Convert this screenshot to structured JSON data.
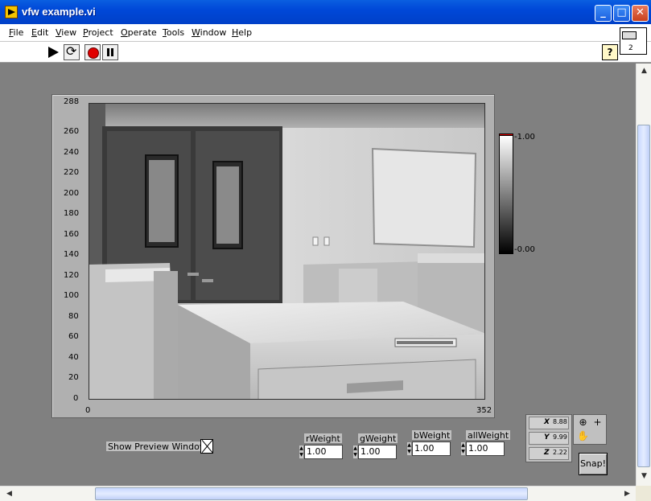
{
  "window": {
    "title": "vfw example.vi",
    "minimize": "_",
    "maximize": "□",
    "close": "✕"
  },
  "menu": [
    "File",
    "Edit",
    "View",
    "Project",
    "Operate",
    "Tools",
    "Window",
    "Help"
  ],
  "toolbar": {
    "help_label": "?",
    "vi_icon_number": "2",
    "icons": [
      "run-arrow-icon",
      "run-continuously-icon",
      "abort-icon",
      "pause-icon",
      "help-icon"
    ]
  },
  "graph": {
    "y_ticks": [
      "288",
      "260",
      "240",
      "220",
      "200",
      "180",
      "160",
      "140",
      "120",
      "100",
      "80",
      "60",
      "40",
      "20",
      "0"
    ],
    "x_ticks": [
      "0",
      "352"
    ],
    "colorbar": {
      "max": "-1.00",
      "min": "-0.00"
    }
  },
  "controls": {
    "show_preview_label": "Show Preview Window?",
    "rweight": {
      "label": "rWeight",
      "value": "1.00"
    },
    "gweight": {
      "label": "gWeight",
      "value": "1.00"
    },
    "bweight": {
      "label": "bWeight",
      "value": "1.00"
    },
    "allweight": {
      "label": "allWeight",
      "value": "1.00"
    },
    "snap_label": "Snap!"
  },
  "scale_legend": {
    "x": {
      "axis": "X",
      "format": "8.88"
    },
    "y": {
      "axis": "Y",
      "format": "9.99"
    },
    "z": {
      "axis": "Z",
      "format": "2.22"
    }
  },
  "tools": {
    "zoom": "⊕",
    "cursor": "+",
    "pan": "✋"
  }
}
